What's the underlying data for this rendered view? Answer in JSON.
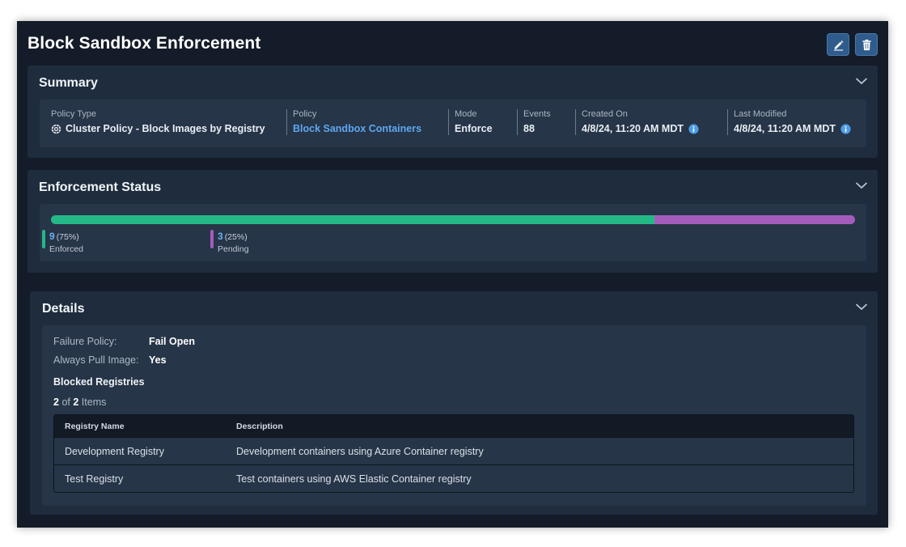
{
  "page": {
    "title": "Block Sandbox Enforcement",
    "edit_icon": "pencil-icon",
    "delete_icon": "trash-icon"
  },
  "summary": {
    "title": "Summary",
    "policy_type_label": "Policy Type",
    "policy_type_value": "Cluster Policy - Block Images by Registry",
    "policy_label": "Policy",
    "policy_value": "Block Sandbox Containers",
    "mode_label": "Mode",
    "mode_value": "Enforce",
    "events_label": "Events",
    "events_value": "88",
    "created_label": "Created On",
    "created_value": "4/8/24, 11:20 AM MDT",
    "modified_label": "Last Modified",
    "modified_value": "4/8/24, 11:20 AM MDT"
  },
  "status": {
    "title": "Enforcement Status",
    "enforced_count": "9",
    "enforced_pct": "(75%)",
    "enforced_label": "Enforced",
    "enforced_fraction": 0.75,
    "pending_count": "3",
    "pending_pct": "(25%)",
    "pending_label": "Pending",
    "pending_fraction": 0.25,
    "colors": {
      "enforced": "#25b887",
      "pending": "#a45cbc"
    }
  },
  "details": {
    "title": "Details",
    "failure_policy_label": "Failure Policy:",
    "failure_policy_value": "Fail Open",
    "always_pull_label": "Always Pull Image:",
    "always_pull_value": "Yes",
    "blocked_registries_title": "Blocked Registries",
    "count_shown": "2",
    "count_of": "of",
    "count_total": "2",
    "count_suffix": "Items",
    "table": {
      "columns": [
        "Registry Name",
        "Description"
      ],
      "rows": [
        [
          "Development Registry",
          "Development containers using Azure Container registry"
        ],
        [
          "Test Registry",
          "Test containers using AWS Elastic Container registry"
        ]
      ]
    }
  },
  "colors": {
    "accent": "#2f5c8c",
    "link": "#5ea8f0",
    "background": "#131c28",
    "panel": "#1e2c3e",
    "card": "#263548"
  }
}
